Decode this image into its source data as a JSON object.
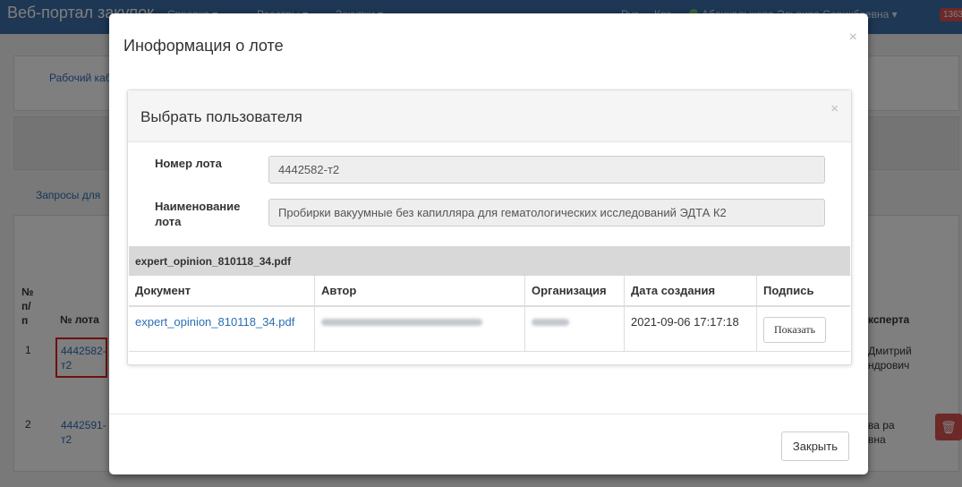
{
  "navbar": {
    "brand": "Веб-портал закупок",
    "menu": [
      "Справка ▾",
      "Реестры ▾",
      "Закупки ▾"
    ],
    "languages": [
      "Рус",
      "Қаз"
    ],
    "user": "Абдикалыкова Эльвира Серикбаевна ▾",
    "badge": "1363"
  },
  "background": {
    "workspace_link": "Рабочий каб",
    "requests_link": "Запросы для",
    "table": {
      "col_num": "№ п/ п",
      "col_lot": "№ лота",
      "col_expert": "ксперта",
      "rows": [
        {
          "num": "1",
          "lot": "4442582-т2",
          "expert": "Дмитрий ндрович"
        },
        {
          "num": "2",
          "lot": "4442591-т2",
          "expert": "ва ра вна"
        }
      ]
    }
  },
  "modal": {
    "title": "Иноформация о лоте",
    "close_button": "Закрыть",
    "close_icon": "×",
    "inner": {
      "title": "Выбрать пользователя",
      "close_icon": "×",
      "lot_number_label": "Номер лота",
      "lot_number_value": "4442582-т2",
      "lot_name_label": "Наименование лота",
      "lot_name_value": "Пробирки вакуумные без капилляра для гематологических исследований ЭДТА К2",
      "file_header": "expert_opinion_810118_34.pdf",
      "table": {
        "headers": [
          "Документ",
          "Автор",
          "Организация",
          "Дата создания",
          "Подпись"
        ],
        "rows": [
          {
            "document": "expert_opinion_810118_34.pdf",
            "date": "2021-09-06 17:17:18",
            "sign_button": "Показать"
          }
        ]
      }
    }
  }
}
